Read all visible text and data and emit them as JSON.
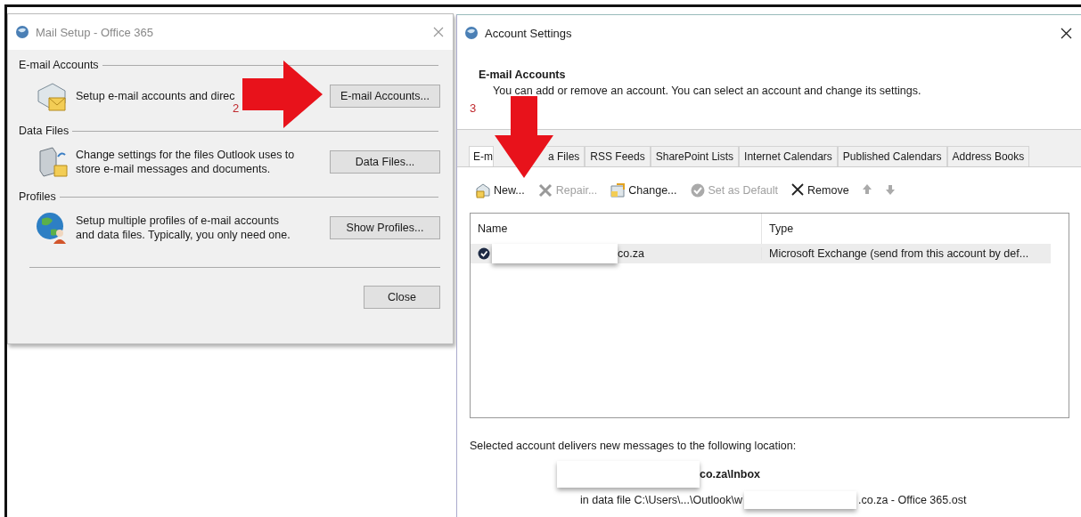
{
  "mail_setup": {
    "title": "Mail Setup - Office 365",
    "sections": [
      {
        "heading": "E-mail Accounts",
        "text": "Setup e-mail accounts and direc",
        "button": "E-mail Accounts...",
        "kind": "mail"
      },
      {
        "heading": "Data Files",
        "text": "Change settings for the files Outlook uses to store e-mail messages and documents.",
        "button": "Data Files...",
        "kind": "files"
      },
      {
        "heading": "Profiles",
        "text": "Setup multiple profiles of e-mail accounts and data files. Typically, you only need one.",
        "button": "Show Profiles...",
        "kind": "profiles"
      }
    ],
    "close_button": "Close"
  },
  "account_settings": {
    "title": "Account Settings",
    "heading": "E-mail Accounts",
    "description": "You can add or remove an account. You can select an account and change its settings.",
    "tabs": [
      {
        "label": "E-m",
        "selected": true
      },
      {
        "label": "a Files",
        "selected": false
      },
      {
        "label": "RSS Feeds",
        "selected": false
      },
      {
        "label": "SharePoint Lists",
        "selected": false
      },
      {
        "label": "Internet Calendars",
        "selected": false
      },
      {
        "label": "Published Calendars",
        "selected": false
      },
      {
        "label": "Address Books",
        "selected": false
      }
    ],
    "toolbar": [
      {
        "kind": "new",
        "label": "New...",
        "disabled": false
      },
      {
        "kind": "repair",
        "label": "Repair...",
        "disabled": true
      },
      {
        "kind": "change",
        "label": "Change...",
        "disabled": false
      },
      {
        "kind": "default",
        "label": "Set as Default",
        "disabled": true
      },
      {
        "kind": "remove",
        "label": "Remove",
        "disabled": false
      },
      {
        "kind": "up",
        "disabled": true
      },
      {
        "kind": "down",
        "disabled": true
      }
    ],
    "columns": [
      "Name",
      "Type"
    ],
    "rows": [
      {
        "name": "co.za",
        "type": "Microsoft Exchange (send from this account by def...",
        "default": true,
        "selected": true,
        "redacted": true
      }
    ],
    "location": {
      "label": "Selected account delivers new messages to the following location:",
      "folder": "co.za\\Inbox",
      "file_prefix": "in data file C:\\Users\\...\\Outlook\\w",
      "file_suffix": ".co.za - Office 365.ost",
      "redacted": true
    }
  },
  "annotations": [
    {
      "kind": "arrow-right",
      "label": "2"
    },
    {
      "kind": "arrow-down",
      "label": "3"
    }
  ]
}
